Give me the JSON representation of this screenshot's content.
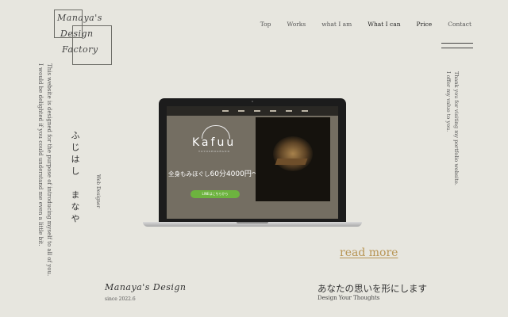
{
  "logo": {
    "line1": "Manaya's",
    "line2": "Design",
    "line3": "Factory"
  },
  "nav": {
    "items": [
      "Top",
      "Works",
      "what I am",
      "What I can",
      "Price",
      "Contact"
    ]
  },
  "intro": {
    "line1": "This website is designed for the purpose of introducing myself to all of you.",
    "line2": "I would be delighted if you could understand me even a little bit."
  },
  "name": "ふじはし　まなや",
  "role": "Web Designer",
  "thanks": {
    "line1": "Thank you for visiting my portfolio website.",
    "line2": "I offer my value to you."
  },
  "screen": {
    "brand": "Kafuu",
    "brand_sub": "TOYOSHOGRAND",
    "price_prefix": "全身もみほぐし",
    "price_main": "60分4000円〜",
    "line_button": "LINEはこちらから"
  },
  "read_more": "read more",
  "footer": {
    "logo": "Manaya's Design",
    "since": "since 2022.6",
    "tagline_jp": "あなたの思いを形にします",
    "tagline_en": "Design Your Thoughts"
  },
  "colors": {
    "background": "#e7e6df",
    "accent": "#b89555",
    "line_green": "#6db33f"
  }
}
